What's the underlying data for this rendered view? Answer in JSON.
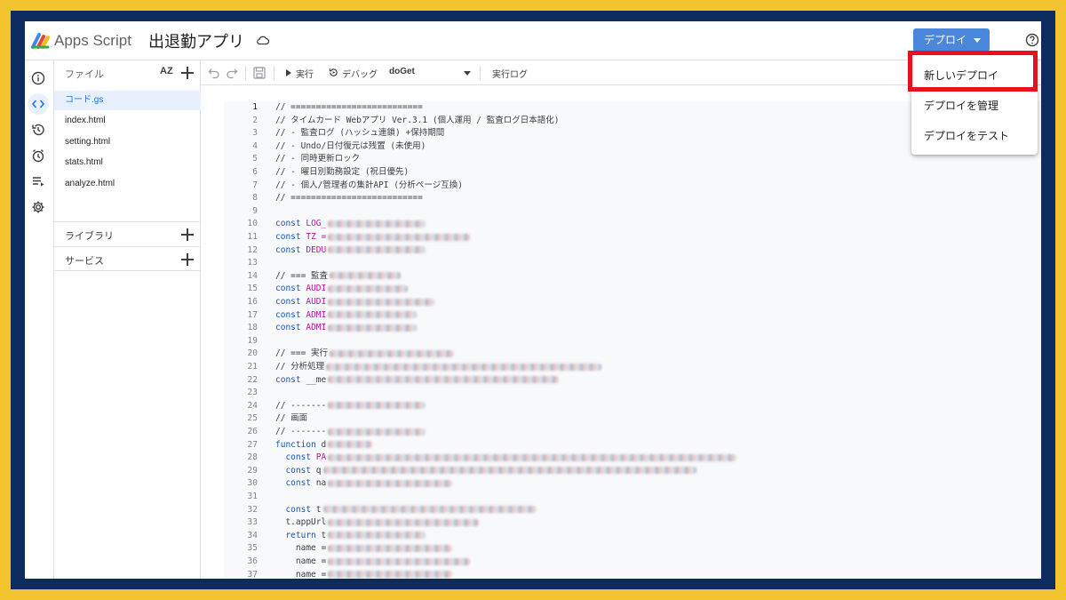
{
  "header": {
    "app_name": "Apps Script",
    "project_title": "出退勤アプリ",
    "deploy_label": "デプロイ"
  },
  "rail": {
    "icons": [
      "info-icon",
      "code-icon",
      "history-icon",
      "alarm-icon",
      "executions-icon",
      "settings-icon"
    ]
  },
  "files": {
    "title": "ファイル",
    "sort_label": "AZ",
    "items": [
      "コード.gs",
      "index.html",
      "setting.html",
      "stats.html",
      "analyze.html"
    ],
    "libraries_label": "ライブラリ",
    "services_label": "サービス"
  },
  "toolbar": {
    "run_label": "実行",
    "debug_label": "デバッグ",
    "function_name": "doGet",
    "log_label": "実行ログ"
  },
  "menu": {
    "items": [
      "新しいデプロイ",
      "デプロイを管理",
      "デプロイをテスト"
    ]
  },
  "code_lines": [
    {
      "n": "1",
      "text": "// ==========================",
      "blur": 0
    },
    {
      "n": "2",
      "text": "// タイムカード Webアプリ Ver.3.1 (個人運用 / 監査ログ日本語化)",
      "blur": 0
    },
    {
      "n": "3",
      "text": "// - 監査ログ (ハッシュ連鎖) +保持期間",
      "blur": 0
    },
    {
      "n": "4",
      "text": "// - Undo/日付復元は残置 (未使用)",
      "blur": 0
    },
    {
      "n": "5",
      "text": "// - 同時更新ロック",
      "blur": 0
    },
    {
      "n": "6",
      "text": "// - 曜日別勤務設定 (祝日優先)",
      "blur": 0
    },
    {
      "n": "7",
      "text": "// - 個人/管理者の集計API (分析ページ互換)",
      "blur": 0
    },
    {
      "n": "8",
      "text": "// ==========================",
      "blur": 0
    },
    {
      "n": "9",
      "text": "",
      "blur": 0
    },
    {
      "n": "10",
      "kw": "const",
      "nm": "LOG_",
      "blur": 110
    },
    {
      "n": "11",
      "kw": "const",
      "nm": "TZ =",
      "blur": 160
    },
    {
      "n": "12",
      "kw": "const",
      "nm": "DEDU",
      "blur": 110
    },
    {
      "n": "13",
      "text": "",
      "blur": 0
    },
    {
      "n": "14",
      "text": "// === 監査",
      "blur": 80
    },
    {
      "n": "15",
      "kw": "const",
      "nm": "AUDI",
      "blur": 90
    },
    {
      "n": "16",
      "kw": "const",
      "nm": "AUDI",
      "blur": 120
    },
    {
      "n": "17",
      "kw": "const",
      "nm": "ADMI",
      "blur": 100
    },
    {
      "n": "18",
      "kw": "const",
      "nm": "ADMI",
      "blur": 100
    },
    {
      "n": "19",
      "text": "",
      "blur": 0
    },
    {
      "n": "20",
      "text": "// === 実行",
      "blur": 140
    },
    {
      "n": "21",
      "text": "// 分析処理",
      "blur": 310
    },
    {
      "n": "22",
      "kw": "const",
      "text": "__me",
      "blur": 260
    },
    {
      "n": "23",
      "text": "",
      "blur": 0
    },
    {
      "n": "24",
      "text": "// -------",
      "blur": 110
    },
    {
      "n": "25",
      "text": "// 画面",
      "blur": 0
    },
    {
      "n": "26",
      "text": "// -------",
      "blur": 110
    },
    {
      "n": "27",
      "kw": "function",
      "text": "d",
      "blur": 50
    },
    {
      "n": "28",
      "kw": "  const",
      "nm": "PA",
      "blur": 460
    },
    {
      "n": "29",
      "kw": "  const",
      "text": "q",
      "blur": 420
    },
    {
      "n": "30",
      "kw": "  const",
      "text": "na",
      "blur": 140
    },
    {
      "n": "31",
      "text": "",
      "blur": 0
    },
    {
      "n": "32",
      "kw": "  const",
      "text": "t",
      "blur": 240
    },
    {
      "n": "33",
      "text": "  t.appUrl",
      "blur": 170
    },
    {
      "n": "34",
      "kw": "  return",
      "text": "t",
      "blur": 110
    },
    {
      "n": "35",
      "text": "    name =",
      "blur": 140
    },
    {
      "n": "36",
      "text": "    name =",
      "blur": 160
    },
    {
      "n": "37",
      "text": "    name =",
      "blur": 140
    }
  ]
}
